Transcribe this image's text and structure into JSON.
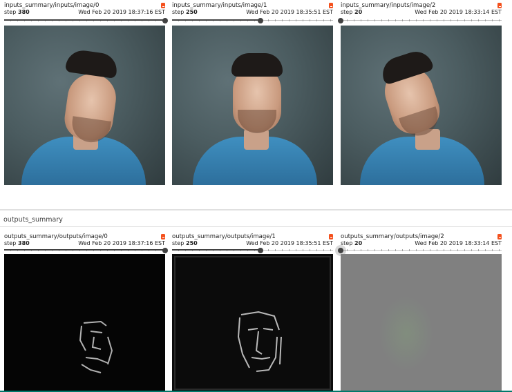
{
  "inputs": [
    {
      "tag": "inputs_summary/inputs/image/0",
      "step_label": "step",
      "step": "380",
      "timestamp": "Wed Feb 20 2019 18:37:16 EST",
      "slider_fraction": 1.0
    },
    {
      "tag": "inputs_summary/inputs/image/1",
      "step_label": "step",
      "step": "250",
      "timestamp": "Wed Feb 20 2019 18:35:51 EST",
      "slider_fraction": 0.55
    },
    {
      "tag": "inputs_summary/inputs/image/2",
      "step_label": "step",
      "step": "20",
      "timestamp": "Wed Feb 20 2019 18:33:14 EST",
      "slider_fraction": 0.0
    }
  ],
  "section": {
    "title": "outputs_summary"
  },
  "outputs": [
    {
      "tag": "outputs_summary/outputs/image/0",
      "step_label": "step",
      "step": "380",
      "timestamp": "Wed Feb 20 2019 18:37:16 EST",
      "slider_fraction": 1.0
    },
    {
      "tag": "outputs_summary/outputs/image/1",
      "step_label": "step",
      "step": "250",
      "timestamp": "Wed Feb 20 2019 18:35:51 EST",
      "slider_fraction": 0.55
    },
    {
      "tag": "outputs_summary/outputs/image/2",
      "step_label": "step",
      "step": "20",
      "timestamp": "Wed Feb 20 2019 18:33:14 EST",
      "slider_fraction": 0.0
    }
  ],
  "colors": {
    "accent": "#f4511e",
    "slider": "#424242",
    "footer": "#00796b"
  },
  "icons": {
    "expand": "expand-icon"
  }
}
